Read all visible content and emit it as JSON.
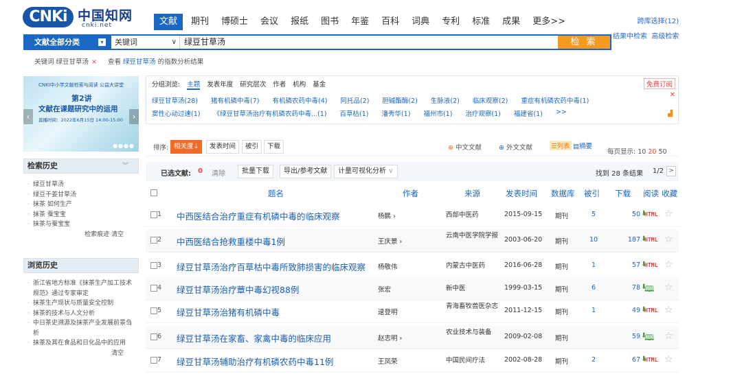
{
  "logo": {
    "mark": "CNKi",
    "cn": "中国知网",
    "net": "cnki.net"
  },
  "nav": [
    "文献",
    "期刊",
    "博硕士",
    "会议",
    "报纸",
    "图书",
    "年鉴",
    "百科",
    "词典",
    "专利",
    "标准",
    "成果",
    "更多>>"
  ],
  "cross_db": "跨库选择(12)",
  "links": {
    "in_result": "结果中检索",
    "advanced": "高级检索"
  },
  "search": {
    "category": "文献全部分类",
    "field": "关键词",
    "query": "绿豆甘草汤",
    "button": "检 索"
  },
  "keyword_line": {
    "label": "关键词 绿豆甘草汤",
    "close": "×",
    "view": "查看",
    "term": "绿豆甘草汤",
    "suffix": "的指数分析结果"
  },
  "banner": {
    "line1": "CNKI中小学文献检索与阅读  公益大讲堂",
    "line2": "第2讲",
    "line3": "文献在课题研究中的运用",
    "line4": "直播时间：2022年6月15日 14:00-15:00"
  },
  "search_history": {
    "title": "检索历史",
    "items": [
      "绿豆甘草汤",
      "绿豆干姜甘草汤",
      "抹茶 如何生产",
      "抹茶 蚕宝宝",
      "抹茶与蚕宝宝"
    ],
    "actions": "检索痕迹   清空"
  },
  "browse_history": {
    "title": "浏览历史",
    "items": [
      "浙江省地方标准《抹茶生产加工技术规范》通过专家审定",
      "抹茶生产现状与质量安全控制",
      "抹茶的技术与人文分析",
      "中日茶史溯源及抹茶产业发展前景刍析",
      "抹茶及其在食品和日化品中的应用"
    ],
    "clear": "清空"
  },
  "grouping": {
    "label": "分组浏览:",
    "tabs": [
      "主题",
      "发表年度",
      "研究层次",
      "作者",
      "机构",
      "基金"
    ],
    "subscribe": "免费订阅",
    "row1": [
      "绿豆甘草汤(28)",
      "猪有机磷中毒(7)",
      "有机磷农药中毒(4)",
      "阿托品(2)",
      "胆碱酯酶(2)",
      "生脉液(2)",
      "临床观察(2)",
      "重症有机磷农药中毒(1)"
    ],
    "row2": [
      "窦性心动过速(1)",
      "《绿豆甘草汤治疗有机磷农药中毒...(1)",
      "百草枯(1)",
      "潘秀华(1)",
      "福州市(1)",
      "治疗观察(1)",
      "福建省(1)",
      ">>"
    ]
  },
  "toolbar": {
    "sort_label": "排序:",
    "sorts": [
      "相关度",
      "发表时间",
      "被引",
      "下载"
    ],
    "zh": "中文文献",
    "en": "外文文献",
    "list": "列表",
    "abstract": "摘要",
    "per_page": "每页显示:",
    "per": [
      "10",
      "20",
      "50"
    ]
  },
  "selbar": {
    "selected": "已选文献:",
    "count": "0",
    "clear": "清除",
    "batch": "批量下载",
    "export": "导出/参考文献",
    "viz": "计量可视化分析",
    "found": "找到 28 条结果",
    "page": "1/2",
    "next": ">"
  },
  "table_header": {
    "title": "题名",
    "author": "作者",
    "source": "来源",
    "date": "发表时间",
    "db": "数据库",
    "cited": "被引",
    "download": "下载",
    "read": "阅读",
    "fav": "收藏"
  },
  "rows": [
    {
      "no": "1",
      "title": "中西医结合治疗重症有机磷中毒的临床观察",
      "author": "杨鹏 ›",
      "source": "西部中医药",
      "date": "2015-09-15",
      "db": "期刊",
      "cited": "5",
      "dl": "50",
      "read": "HTML"
    },
    {
      "no": "2",
      "title": "中西医结合抢救重楼中毒1例",
      "author": "王庆景 ›",
      "source": "云南中医学院学报",
      "date": "2003-06-20",
      "db": "期刊",
      "cited": "10",
      "dl": "187",
      "read": "HTML"
    },
    {
      "no": "3",
      "title": "绿豆甘草汤治疗百草枯中毒所致肺损害的临床观察",
      "author": "杨敬伟",
      "source": "内蒙古中医药",
      "date": "2016-06-28",
      "db": "期刊",
      "cited": "1",
      "dl": "57",
      "read": "HTML"
    },
    {
      "no": "4",
      "title": "绿豆甘草汤治疗蕈中毒幻视88例",
      "author": "张宏",
      "source": "新中医",
      "date": "1999-03-15",
      "db": "期刊",
      "cited": "6",
      "dl": "78",
      "read": "book"
    },
    {
      "no": "5",
      "title": "绿豆甘草汤治猪有机磷中毒",
      "author": "逯登明",
      "source": "青海畜牧兽医杂志",
      "date": "2011-12-15",
      "db": "期刊",
      "cited": "1",
      "dl": "49",
      "read": "HTML"
    },
    {
      "no": "6",
      "title": "绿豆甘草汤在家畜、家禽中毒的临床应用",
      "author": "赵志明 ›",
      "source": "农业技术与装备",
      "date": "2009-02-08",
      "db": "期刊",
      "cited": "",
      "dl": "59",
      "read": "book"
    },
    {
      "no": "7",
      "title": "绿豆甘草汤辅助治疗有机磷农药中毒11例",
      "author": "王凤荣",
      "source": "中国民间疗法",
      "date": "2002-08-28",
      "db": "期刊",
      "cited": "2",
      "dl": "67",
      "read": "HTML"
    }
  ]
}
